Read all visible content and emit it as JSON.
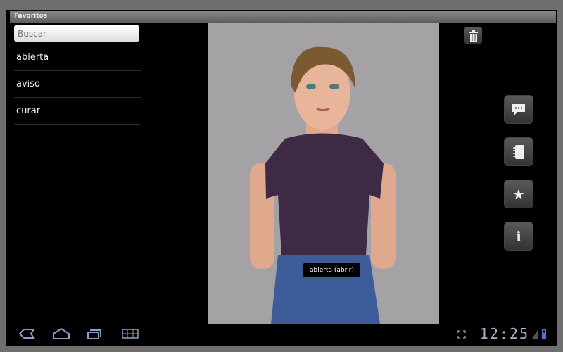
{
  "window": {
    "title": "Favoritos"
  },
  "search": {
    "placeholder": "Buscar"
  },
  "favorites": [
    "abierta",
    "aviso",
    "curar"
  ],
  "viewport": {
    "caption": "abierta (abrir)"
  },
  "side_buttons": [
    {
      "icon": "chat-icon"
    },
    {
      "icon": "notebook-icon"
    },
    {
      "icon": "star-icon"
    },
    {
      "icon": "info-icon"
    }
  ],
  "status": {
    "time": "12:25"
  },
  "colors": {
    "shirt": "#3f2a45",
    "background": "#a5a2a6",
    "nav_icon": "#8aa0c8"
  }
}
